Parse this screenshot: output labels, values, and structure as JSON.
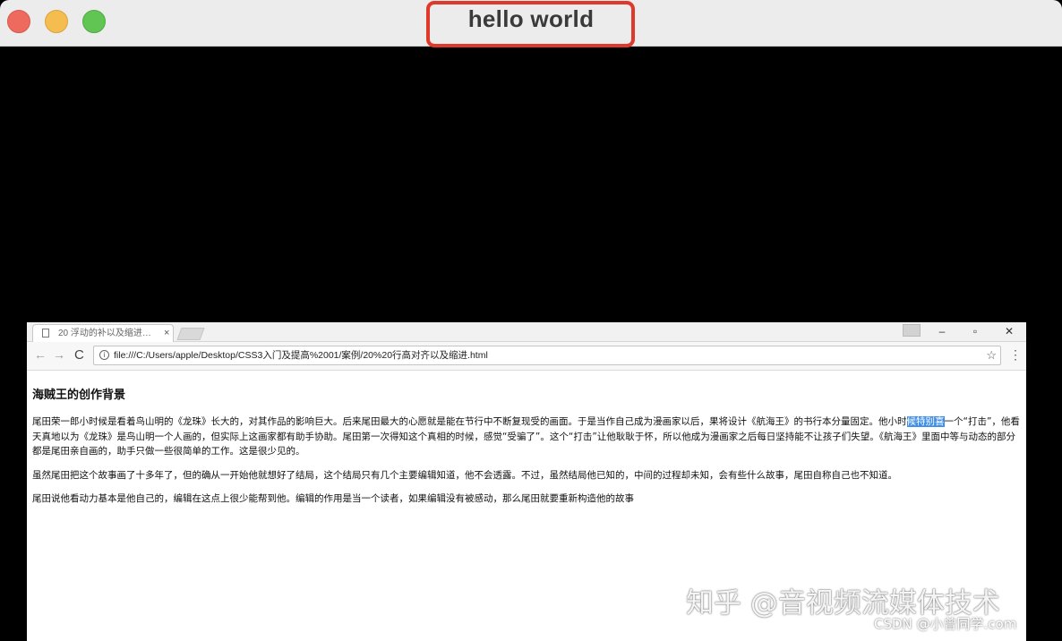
{
  "window": {
    "title": "hello world",
    "traffic_lights": [
      "close",
      "minimize",
      "maximize"
    ]
  },
  "browser": {
    "tab_title": "20 浮动的补以及缩进…",
    "tab_close": "×",
    "window_controls": {
      "minimize": "–",
      "restore": "▫",
      "close": "✕"
    },
    "nav": {
      "back": "←",
      "forward": "→",
      "reload": "C"
    },
    "address_info_icon": "i",
    "url": "file:///C:/Users/apple/Desktop/CSS3入门及提高%2001/案例/20%20行高对齐以及缩进.html",
    "bookmark_star": "☆",
    "menu": "⋮",
    "page": {
      "heading": "海贼王的创作背景",
      "p1_before": "尾田荣一郎小时候是看着鸟山明的《龙珠》长大的，对其作品的影响巨大。后来尾田最大的心愿就是能在节行中不断复现受的画面。于是当作自己成为漫画家以后，果将设计《航海王》的书行本分量固定。他小时",
      "p1_highlight": "候特别喜",
      "p1_after": "一个“打击”，他看天真地以为《龙珠》是鸟山明一个人画的，但实际上这画家都有助手协助。尾田第一次得知这个真相的时候，感觉“受骗了”。这个“打击”让他耿耿于怀，所以他成为漫画家之后每日坚持能不让孩子们失望。《航海王》里面中等与动态的部分都是尾田亲自画的，助手只做一些很简单的工作。这是很少见的。",
      "p2": "虽然尾田把这个故事画了十多年了，但的确从一开始他就想好了结局，这个结局只有几个主要编辑知道，他不会透露。不过，虽然结局他已知的，中间的过程却未知，会有些什么故事，尾田自称自己也不知道。",
      "p3": "尾田说他看动力基本是他自己的，编辑在这点上很少能帮到他。编辑的作用是当一个读者，如果编辑没有被感动，那么尾田就要重新构造他的故事"
    }
  },
  "watermarks": {
    "zhihu": "知乎 @音视频流媒体技术",
    "csdn": "CSDN @小曾同学.com"
  },
  "colors": {
    "title_highlight_border": "#e0382b",
    "selection": "#3f8fe6",
    "close": "#ee6a5f",
    "minimize": "#f5bd4f",
    "maximize": "#61c554"
  }
}
